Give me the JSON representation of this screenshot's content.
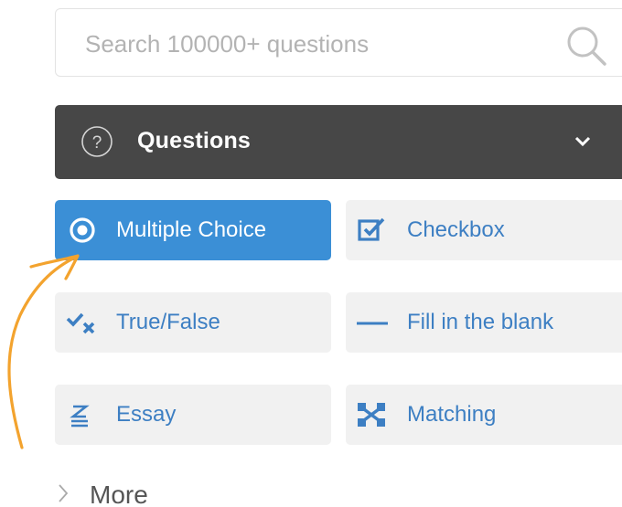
{
  "search": {
    "placeholder": "Search 100000+ questions",
    "value": "",
    "icon": "search-icon"
  },
  "header": {
    "title": "Questions",
    "icon": "help-circle-icon",
    "toggle_icon": "chevron-down-icon"
  },
  "question_types": [
    {
      "label": "Multiple Choice",
      "icon": "radio-target-icon",
      "active": true
    },
    {
      "label": "Checkbox",
      "icon": "checkbox-icon",
      "active": false
    },
    {
      "label": "True/False",
      "icon": "check-cross-icon",
      "active": false
    },
    {
      "label": "Fill in the blank",
      "icon": "dash-icon",
      "active": false
    },
    {
      "label": "Essay",
      "icon": "text-lines-icon",
      "active": false
    },
    {
      "label": "Matching",
      "icon": "matching-icon",
      "active": false
    }
  ],
  "more": {
    "label": "More",
    "icon": "chevron-right-icon"
  },
  "annotation": {
    "icon": "orange-arrow-icon",
    "color": "#f3a32e"
  },
  "colors": {
    "accent": "#3b8fd6",
    "header_bg": "#474747",
    "tile_bg": "#f1f1f1",
    "tile_text": "#3d7fc3"
  }
}
